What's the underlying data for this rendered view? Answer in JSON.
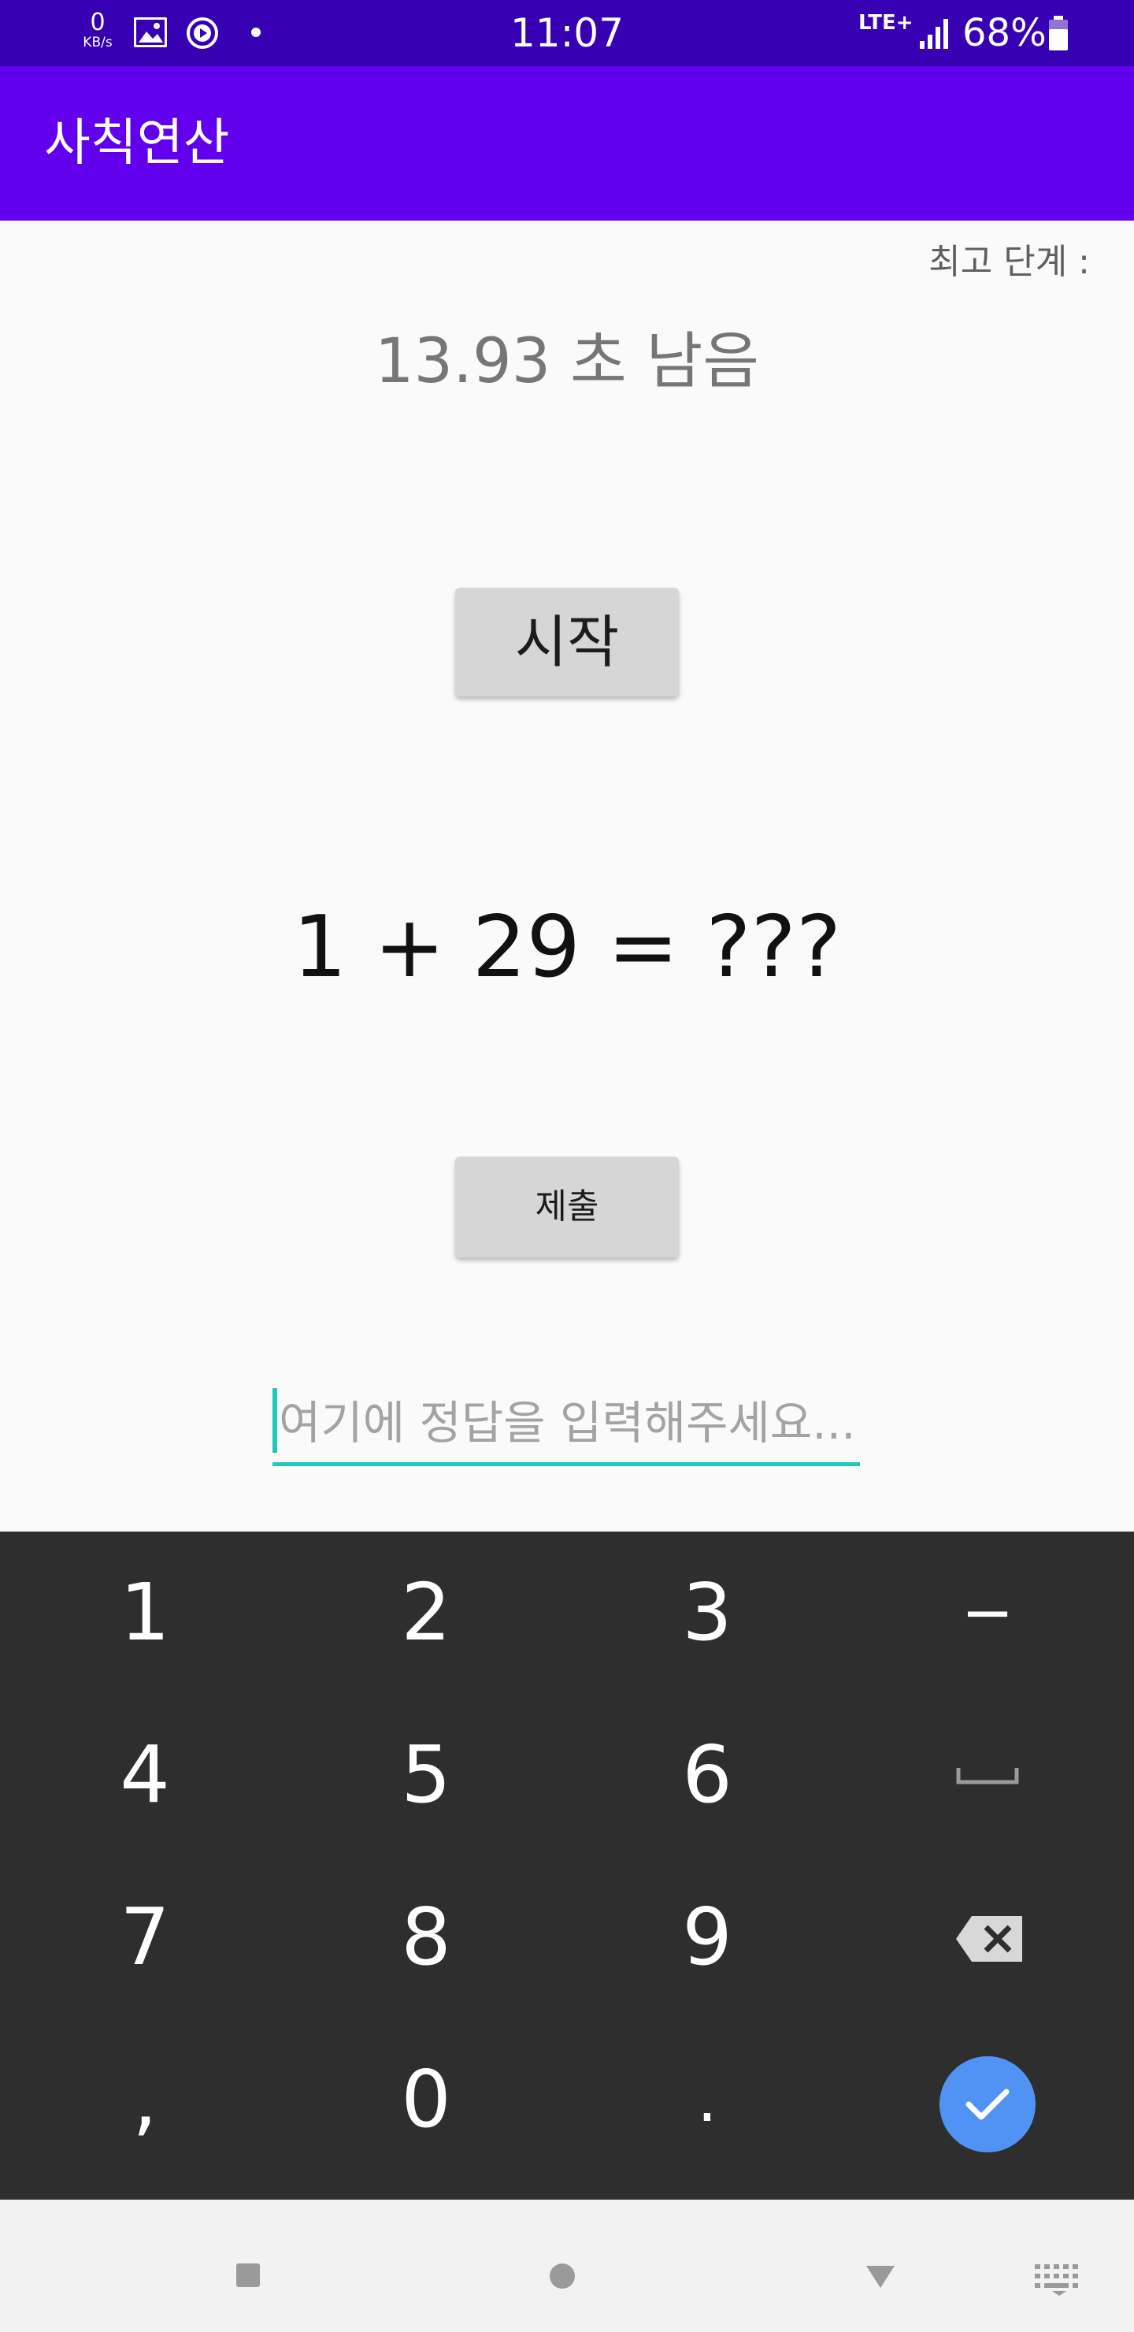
{
  "status_bar": {
    "speed_value": "0",
    "speed_unit": "KB/s",
    "time": "11:07",
    "network": "LTE+",
    "battery": "68%",
    "icons": [
      "image-icon",
      "play-icon",
      "dot-icon",
      "signal-icon",
      "battery-icon"
    ]
  },
  "app_bar": {
    "title": "사칙연산"
  },
  "main": {
    "best_level_label": "최고 단계 :",
    "timer_text": "13.93 초 남음",
    "start_button": "시작",
    "problem": "1 + 29 = ???",
    "submit_button": "제출",
    "answer_placeholder": "여기에 정답을 입력해주세요...",
    "answer_value": ""
  },
  "keyboard": {
    "keys": [
      [
        "1",
        "2",
        "3",
        "−"
      ],
      [
        "4",
        "5",
        "6",
        "space"
      ],
      [
        "7",
        "8",
        "9",
        "backspace"
      ],
      [
        ",",
        "0",
        ".",
        "done"
      ]
    ],
    "done_color": "#5193f5"
  },
  "nav_bar": {
    "icons": [
      "recent-apps-icon",
      "home-icon",
      "back-icon",
      "keyboard-switch-icon"
    ]
  },
  "colors": {
    "status_bar": "#3700b3",
    "app_bar": "#6200ee",
    "accent": "#1fc9b8",
    "keyboard": "#2e2e2e"
  }
}
